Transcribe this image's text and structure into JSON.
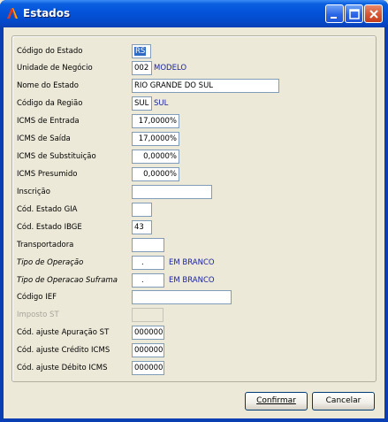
{
  "window": {
    "title": "Estados"
  },
  "fields": [
    {
      "id": "codigo-estado",
      "label": "Código do Estado",
      "value": "RS"
    },
    {
      "id": "unidade-negocio",
      "label": "Unidade de Negócio",
      "value": "002",
      "extra": "MODELO"
    },
    {
      "id": "nome-estado",
      "label": "Nome do Estado",
      "value": "RIO GRANDE DO SUL"
    },
    {
      "id": "codigo-regiao",
      "label": "Código da Região",
      "value": "SUL",
      "extra": "SUL"
    },
    {
      "id": "icms-entrada",
      "label": "ICMS de Entrada",
      "value": "17,0000%"
    },
    {
      "id": "icms-saida",
      "label": "ICMS de Saída",
      "value": "17,0000%"
    },
    {
      "id": "icms-substituicao",
      "label": "ICMS de Substituição",
      "value": "0,0000%"
    },
    {
      "id": "icms-presumido",
      "label": "ICMS Presumido",
      "value": "0,0000%"
    },
    {
      "id": "inscricao",
      "label": "Inscrição",
      "value": ""
    },
    {
      "id": "cod-estado-gia",
      "label": "Cód. Estado GIA",
      "value": ""
    },
    {
      "id": "cod-estado-ibge",
      "label": "Cód. Estado IBGE",
      "value": "43"
    },
    {
      "id": "transportadora",
      "label": "Transportadora",
      "value": ""
    },
    {
      "id": "tipo-operacao",
      "label": "Tipo de Operação",
      "value": ".",
      "extra": "EM BRANCO"
    },
    {
      "id": "tipo-operacao-suframa",
      "label": "Tipo de Operacao Suframa",
      "value": ".",
      "extra": "EM BRANCO"
    },
    {
      "id": "codigo-ief",
      "label": "Código IEF",
      "value": ""
    },
    {
      "id": "imposto-st",
      "label": "Imposto ST",
      "value": ""
    },
    {
      "id": "cod-ajuste-apuracao-st",
      "label": "Cód. ajuste Apuração ST",
      "value": "000000"
    },
    {
      "id": "cod-ajuste-credito-icms",
      "label": "Cód. ajuste Crédito ICMS",
      "value": "000000"
    },
    {
      "id": "cod-ajuste-debito-icms",
      "label": "Cód. ajuste Débito ICMS",
      "value": "000000"
    }
  ],
  "buttons": {
    "confirm_label": "Confirmar",
    "cancel_label": "Cancelar"
  },
  "colors": {
    "title_bar": "#0a5fe0",
    "selection": "#316ac5",
    "link_text": "#1b22a6"
  }
}
